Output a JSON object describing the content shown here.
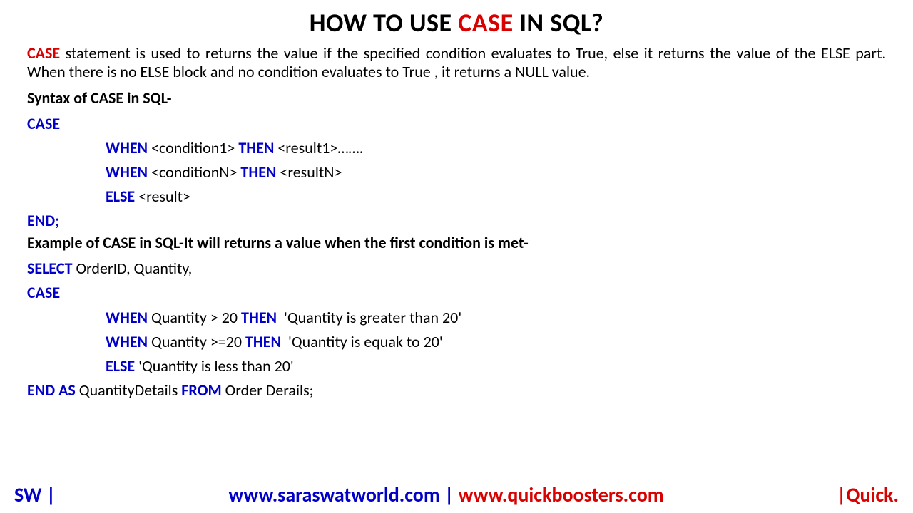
{
  "title": {
    "pre": "HOW TO USE ",
    "highlight": "CASE",
    "post": " IN SQL?"
  },
  "intro": {
    "lead": "CASE",
    "rest": " statement is used to returns the value if the specified condition evaluates to True, else it returns the  value of the ELSE part. When there is no ELSE block and no condition evaluates to True , it returns a NULL value."
  },
  "syntax_label": "Syntax of CASE in SQL-",
  "syntax": {
    "case": "CASE",
    "when1_kw1": "WHEN",
    "when1_t1": " <condition1> ",
    "when1_kw2": "THEN",
    "when1_t2": " <result1>…….",
    "whenN_kw1": "WHEN",
    "whenN_t1": " <conditionN> ",
    "whenN_kw2": "THEN",
    "whenN_t2": " <resultN>",
    "else_kw": "ELSE",
    "else_t": " <result>",
    "end": "END;"
  },
  "example_label": "Example of CASE in SQL-It will returns a value when the first condition is met-",
  "example": {
    "select_kw": "SELECT",
    "select_t": " OrderID, Quantity,",
    "case": "CASE",
    "w1_kw1": "WHEN",
    "w1_t1": " Quantity > 20 ",
    "w1_kw2": "THEN",
    "w1_t2": "  'Quantity is greater than 20'",
    "w2_kw1": "WHEN",
    "w2_t1": " Quantity >=20 ",
    "w2_kw2": "THEN",
    "w2_t2": "  'Quantity is equak to 20'",
    "else_kw": "ELSE",
    "else_t": " 'Quantity is less than 20'",
    "end_kw1": "END AS",
    "end_t1": " QuantityDetails ",
    "end_kw2": "FROM",
    "end_t2": " Order Derails;"
  },
  "footer": {
    "left": "SW |",
    "center_blue": "www.saraswatworld.com",
    "center_sep": " | ",
    "center_red": "www.quickboosters.com",
    "right": "|Quick."
  }
}
